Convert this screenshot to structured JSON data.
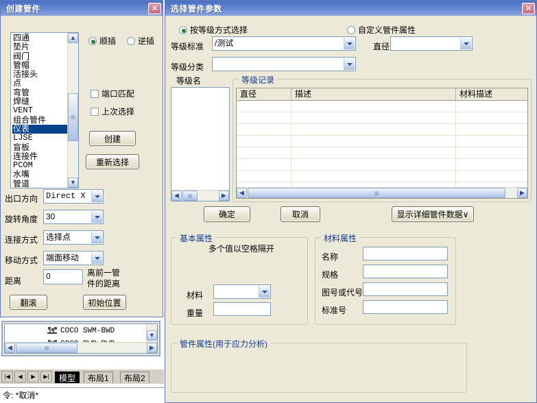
{
  "left_window": {
    "title": "创建管件",
    "close_icon": "close-icon",
    "fitting_list": {
      "items": [
        "四通",
        "垫片",
        "阀门",
        "管帽",
        "活接头",
        "点",
        "弯管",
        "焊缝",
        "VENT",
        "组合管件",
        "仪表",
        "LJSE",
        "盲板",
        "连接件",
        "PCOM",
        "水嘴",
        "管道"
      ],
      "selected": "仪表"
    },
    "radios": [
      {
        "label": "顺插",
        "checked": true
      },
      {
        "label": "逆插",
        "checked": false
      }
    ],
    "checkboxes": [
      {
        "label": "端口匹配",
        "checked": false
      },
      {
        "label": "上次选择",
        "checked": false
      }
    ],
    "buttons": {
      "create": "创建",
      "reselect": "重新选择",
      "roll": "翻滚",
      "init_position": "初始位置"
    },
    "fields": [
      {
        "label": "出口方向",
        "value": "Direct X",
        "type": "combo",
        "mono": true
      },
      {
        "label": "旋转角度",
        "value": "30",
        "type": "combo",
        "mono": false
      },
      {
        "label": "连接方式",
        "value": "选择点",
        "type": "combo",
        "mono": false
      },
      {
        "label": "移动方式",
        "value": "端面移动",
        "type": "combo",
        "mono": false
      }
    ],
    "distance": {
      "label": "距离",
      "value": "0",
      "hint_line1": "离前一管",
      "hint_line2": "件的距离"
    },
    "tree": {
      "items": [
        "COCO SWM-BWD",
        "COCO BWD-BWD"
      ]
    },
    "nav_buttons": [
      "|◀",
      "◀",
      "▶",
      "▶|"
    ],
    "tabs": [
      {
        "label": "模型",
        "active": true
      },
      {
        "label": "布局1",
        "active": false
      },
      {
        "label": "布局2",
        "active": false
      }
    ],
    "command_line": "令: *取消*"
  },
  "right_window": {
    "title": "选择管件参数",
    "close_icon": "close-icon",
    "mode_radios": [
      {
        "label": "按等级方式选择",
        "checked": true
      },
      {
        "label": "自定义管件属性",
        "checked": false
      }
    ],
    "fields": {
      "spec_standard": {
        "label": "等级标准",
        "value": "/测试"
      },
      "diameter": {
        "label": "直径",
        "value": ""
      },
      "spec_class": {
        "label": "等级分类",
        "value": ""
      },
      "spec_name": {
        "label": "等级名"
      }
    },
    "records_group": {
      "title": "等级记录",
      "columns": [
        "直径",
        "描述",
        "材料描述"
      ],
      "rows": [],
      "empty_row_count": 9
    },
    "buttons": {
      "ok": "确定",
      "cancel": "取消",
      "show_detail": "显示详细管件数据∨"
    },
    "basic_props": {
      "title": "基本属性",
      "note": "多个值以空格隔开",
      "material": {
        "label": "材料",
        "value": ""
      },
      "weight": {
        "label": "重量",
        "value": ""
      }
    },
    "material_props": {
      "title": "材料属性",
      "rows": [
        {
          "label": "名称",
          "value": ""
        },
        {
          "label": "规格",
          "value": ""
        },
        {
          "label": "图号或代号",
          "value": ""
        },
        {
          "label": "标准号",
          "value": ""
        }
      ]
    },
    "fitting_props": {
      "title": "管件属性(用于应力分析)"
    }
  },
  "colors": {
    "title_bar_start": "#4a6fc4",
    "title_bar_end": "#8aa5dd",
    "dialog_face": "#ece9d8",
    "group_title": "#123a8f",
    "selection": "#08418c",
    "close_button": "#c4677f"
  }
}
